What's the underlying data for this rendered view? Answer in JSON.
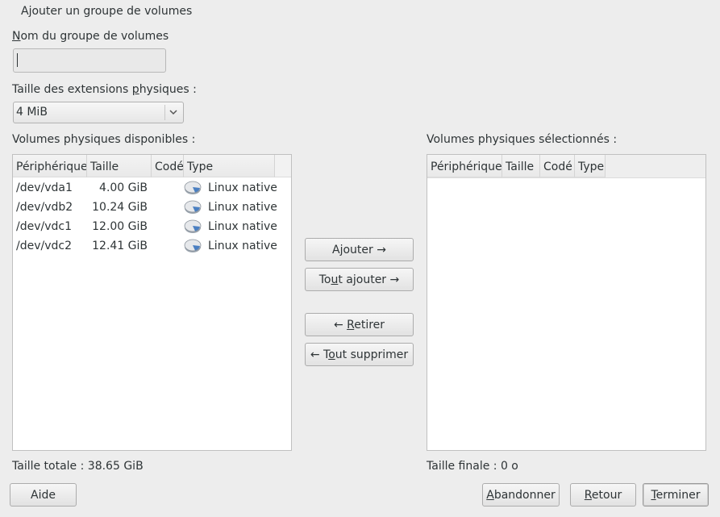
{
  "window": {
    "title": "Ajouter un groupe de volumes"
  },
  "vg_name": {
    "label_prefix": "",
    "label_mnemonic": "N",
    "label_rest": "om du groupe de volumes",
    "value": "",
    "placeholder": ""
  },
  "extent": {
    "label_prefix": "Taille des extensions ",
    "label_mnemonic": "p",
    "label_rest": "hysiques :",
    "selected": "4 MiB"
  },
  "available": {
    "title": "Volumes physiques disponibles :",
    "columns": [
      "Périphérique",
      "Taille",
      "Codé",
      "Type"
    ],
    "rows": [
      {
        "device": "/dev/vda1",
        "size": "4.00 GiB",
        "encrypted": "",
        "type": "Linux native",
        "icon": "hard-disk-icon"
      },
      {
        "device": "/dev/vdb2",
        "size": "10.24 GiB",
        "encrypted": "",
        "type": "Linux native",
        "icon": "hard-disk-icon"
      },
      {
        "device": "/dev/vdc1",
        "size": "12.00 GiB",
        "encrypted": "",
        "type": "Linux native",
        "icon": "hard-disk-icon"
      },
      {
        "device": "/dev/vdc2",
        "size": "12.41 GiB",
        "encrypted": "",
        "type": "Linux native",
        "icon": "hard-disk-icon"
      }
    ],
    "total_label": "Taille totale :",
    "total_value": "38.65 GiB"
  },
  "selected": {
    "title": "Volumes physiques sélectionnés :",
    "columns": [
      "Périphérique",
      "Taille",
      "Codé",
      "Type"
    ],
    "final_label": "Taille finale :",
    "final_value": "0 o"
  },
  "actions": {
    "add": {
      "pre": "Ajouter →",
      "mn": "",
      "post": ""
    },
    "add_all": {
      "pre": "To",
      "mn": "u",
      "post": "t ajouter →"
    },
    "remove": {
      "pre": "← ",
      "mn": "R",
      "post": "etirer"
    },
    "remove_all": {
      "pre": "← T",
      "mn": "o",
      "post": "ut supprimer"
    }
  },
  "footer": {
    "help": "Aide",
    "abort": {
      "mn": "A",
      "post": "bandonner"
    },
    "back": {
      "mn": "R",
      "post": "etour"
    },
    "finish": {
      "mn": "T",
      "post": "erminer"
    }
  },
  "colors": {
    "background": "#ededed",
    "text": "#2e3436",
    "list_bg": "#ffffff"
  }
}
